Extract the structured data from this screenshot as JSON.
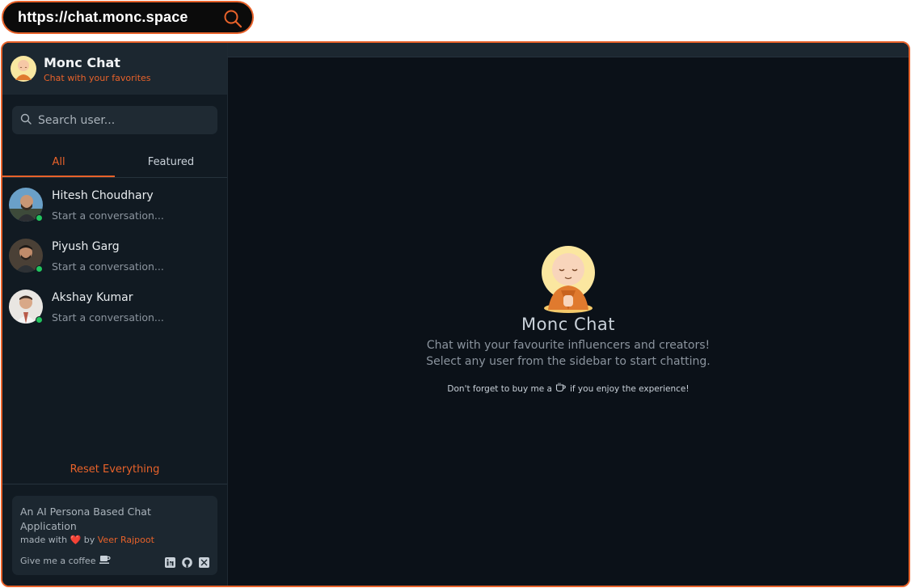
{
  "browser": {
    "url": "https://chat.monc.space"
  },
  "brand": {
    "title": "Monc Chat",
    "subtitle": "Chat with your favorites"
  },
  "search": {
    "placeholder": "Search user..."
  },
  "tabs": [
    {
      "label": "All",
      "active": true
    },
    {
      "label": "Featured",
      "active": false
    }
  ],
  "users": [
    {
      "name": "Hitesh Choudhary",
      "preview": "Start a conversation...",
      "online": true
    },
    {
      "name": "Piyush Garg",
      "preview": "Start a conversation...",
      "online": true
    },
    {
      "name": "Akshay Kumar",
      "preview": "Start a conversation...",
      "online": true
    }
  ],
  "sidebar": {
    "reset_label": "Reset Everything"
  },
  "footer": {
    "description": "An AI Persona Based Chat Application",
    "made_with_prefix": "made with",
    "made_with_by": "by",
    "author": "Veer Rajpoot",
    "coffee_label": "Give me a coffee",
    "social_icons": [
      "linkedin-icon",
      "github-icon",
      "x-icon"
    ]
  },
  "main": {
    "title": "Monc Chat",
    "line1": "Chat with your favourite influencers and creators!",
    "line2": "Select any user from the sidebar to start chatting.",
    "note_prefix": "Don't forget to buy me a",
    "note_suffix": "if you enjoy the experience!"
  },
  "colors": {
    "accent": "#e8622a",
    "online": "#22c55e",
    "background": "#0b1118",
    "sidebar": "#111a22"
  }
}
